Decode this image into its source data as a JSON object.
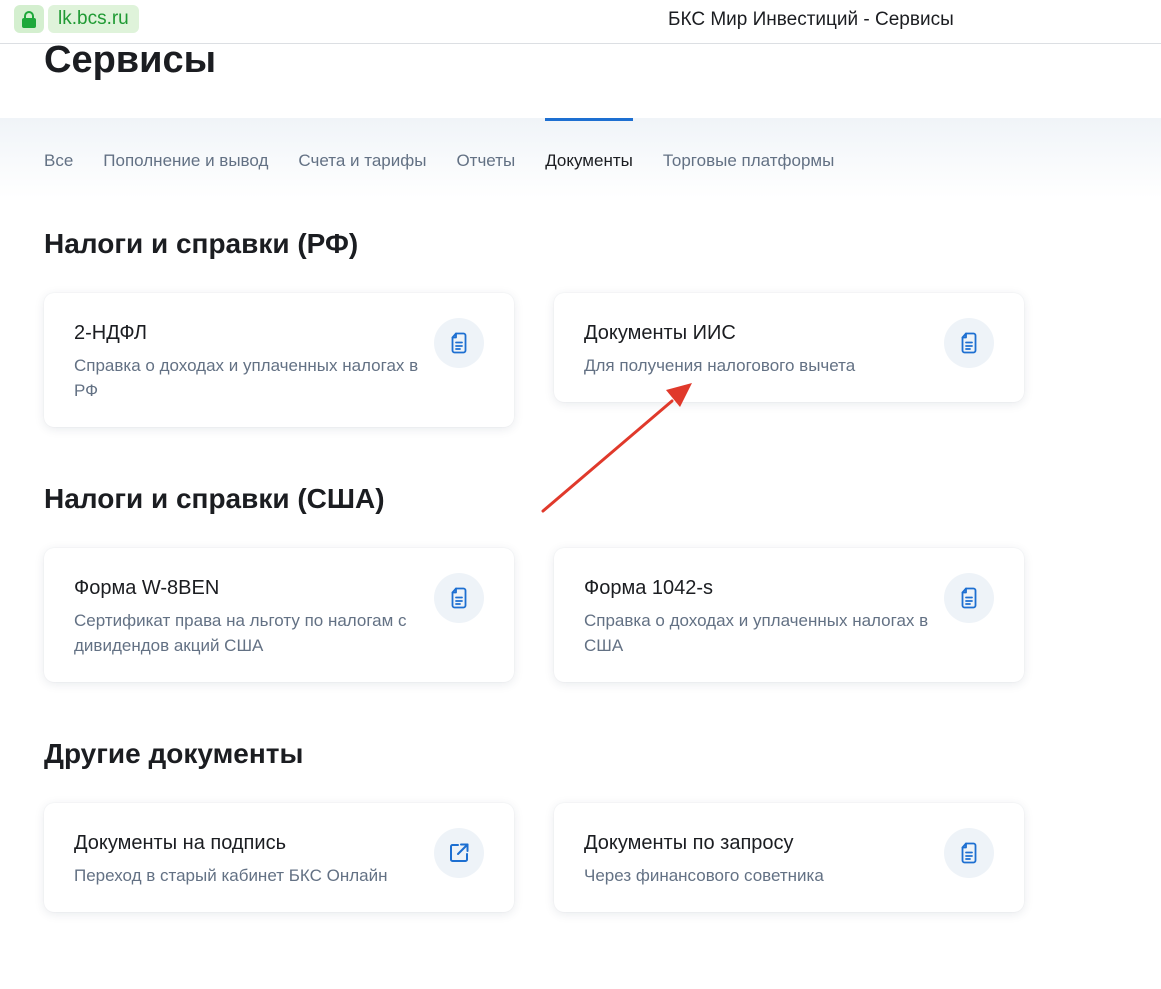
{
  "browser": {
    "domain": "lk.bcs.ru",
    "window_title": "БКС Мир Инвестиций - Сервисы"
  },
  "page": {
    "title": "Сервисы"
  },
  "tabs": [
    {
      "label": "Все",
      "active": false
    },
    {
      "label": "Пополнение и вывод",
      "active": false
    },
    {
      "label": "Счета и тарифы",
      "active": false
    },
    {
      "label": "Отчеты",
      "active": false
    },
    {
      "label": "Документы",
      "active": true
    },
    {
      "label": "Торговые платформы",
      "active": false
    }
  ],
  "sections": [
    {
      "title": "Налоги и справки (РФ)",
      "cards": [
        {
          "title": "2-НДФЛ",
          "description": "Справка о доходах и уплаченных налогах в РФ",
          "icon": "document-icon"
        },
        {
          "title": "Документы ИИС",
          "description": "Для получения налогового вычета",
          "icon": "document-icon"
        }
      ]
    },
    {
      "title": "Налоги и справки (США)",
      "cards": [
        {
          "title": "Форма W-8BEN",
          "description": "Сертификат права на льготу по налогам с дивидендов акций США",
          "icon": "document-icon"
        },
        {
          "title": "Форма 1042-s",
          "description": "Справка о доходах и уплаченных налогах в США",
          "icon": "document-icon"
        }
      ]
    },
    {
      "title": "Другие документы",
      "cards": [
        {
          "title": "Документы на подпись",
          "description": "Переход в старый кабинет БКС Онлайн",
          "icon": "external-link-icon"
        },
        {
          "title": "Документы по запросу",
          "description": "Через финансового советника",
          "icon": "document-icon"
        }
      ]
    }
  ],
  "colors": {
    "accent": "#1d6fd1",
    "secure_green": "#1ea83a",
    "annotation_arrow": "#e0392b",
    "muted_text": "#637184"
  }
}
